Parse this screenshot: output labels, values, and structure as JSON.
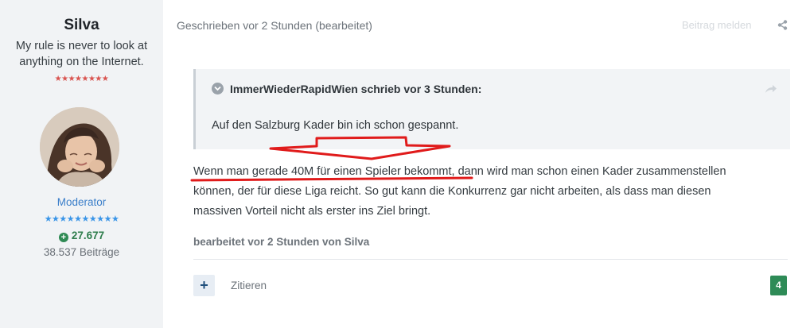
{
  "author": {
    "name": "Silva",
    "title": "My rule is never to look at anything on the Internet.",
    "rank_stars_red": "★★★★★★★★",
    "group": "Moderator",
    "rank_stars_blue": "★★★★★★★★★★",
    "reputation": "27.677",
    "post_count": "38.537 Beiträge"
  },
  "post": {
    "meta": "Geschrieben vor 2 Stunden (bearbeitet)",
    "report_label": "Beitrag melden",
    "quote": {
      "header": "ImmerWiederRapidWien schrieb vor 3 Stunden:",
      "text": "Auf den Salzburg Kader bin ich schon gespannt."
    },
    "body_line1": "Wenn man gerade 40M für einen Spieler bekommt, dann wird man schon einen Kader zusammenstellen",
    "body_line2": "können, der für diese Liga reicht. So gut kann die Konkurrenz gar nicht arbeiten, als dass man diesen",
    "body_line3": "massiven Vorteil nicht als erster ins Ziel bringt.",
    "edit_note": "bearbeitet vor 2 Stunden von Silva",
    "add_label": "+",
    "quote_button": "Zitieren",
    "reaction_count": "4"
  },
  "colors": {
    "annotation_red": "#e01b1b",
    "reputation_green": "#2e8b57",
    "group_blue": "#3a7ec9"
  },
  "icons": [
    "chevron-down-icon",
    "share-icon",
    "plus-icon",
    "reputation-plus-icon"
  ]
}
